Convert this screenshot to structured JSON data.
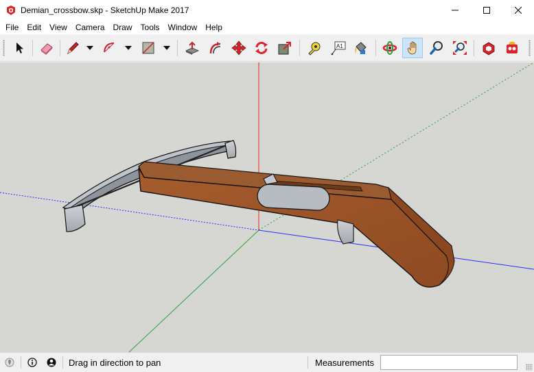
{
  "window": {
    "title": "Demian_crossbow.skp - SketchUp Make 2017",
    "controls": [
      "minimize-icon",
      "maximize-icon",
      "close-icon"
    ]
  },
  "menu": [
    "File",
    "Edit",
    "View",
    "Camera",
    "Draw",
    "Tools",
    "Window",
    "Help"
  ],
  "toolbar": {
    "tools": [
      {
        "name": "select-tool",
        "icon": "arrow-cursor-icon"
      },
      {
        "name": "eraser-tool",
        "icon": "eraser-icon"
      },
      {
        "name": "line-tool",
        "icon": "pencil-icon",
        "dropdown": true
      },
      {
        "name": "arc-tool",
        "icon": "arc-icon",
        "dropdown": true
      },
      {
        "name": "rectangle-tool",
        "icon": "rectangle-icon",
        "dropdown": true
      },
      {
        "name": "push-pull-tool",
        "icon": "push-pull-icon"
      },
      {
        "name": "offset-tool",
        "icon": "offset-icon"
      },
      {
        "name": "move-tool",
        "icon": "move-icon"
      },
      {
        "name": "rotate-tool",
        "icon": "rotate-icon"
      },
      {
        "name": "scale-tool",
        "icon": "scale-icon"
      },
      {
        "name": "tape-measure-tool",
        "icon": "tape-measure-icon"
      },
      {
        "name": "text-tool",
        "icon": "text-icon"
      },
      {
        "name": "paint-bucket-tool",
        "icon": "paint-bucket-icon"
      },
      {
        "name": "orbit-tool",
        "icon": "orbit-icon"
      },
      {
        "name": "pan-tool",
        "icon": "hand-icon",
        "active": true
      },
      {
        "name": "zoom-tool",
        "icon": "magnifier-icon"
      },
      {
        "name": "zoom-extents-tool",
        "icon": "zoom-extents-icon"
      },
      {
        "name": "warehouse-tool",
        "icon": "3d-warehouse-icon"
      },
      {
        "name": "extension-warehouse-tool",
        "icon": "extension-warehouse-icon"
      }
    ],
    "text_tool_label": "A1"
  },
  "colors": {
    "viewport_bg": "#d6d6d3",
    "axis_red": "#e0262a",
    "axis_green": "#22a33a",
    "axis_blue": "#2a2aff",
    "wood": "#a2582a",
    "metal": "#b7bcc2",
    "pan_active_bg": "#cce4f7"
  },
  "status": {
    "hint": "Drag in direction to pan",
    "measurements_label": "Measurements",
    "measurements_value": "",
    "icons": [
      "geo-location-icon",
      "info-icon",
      "user-icon"
    ]
  }
}
